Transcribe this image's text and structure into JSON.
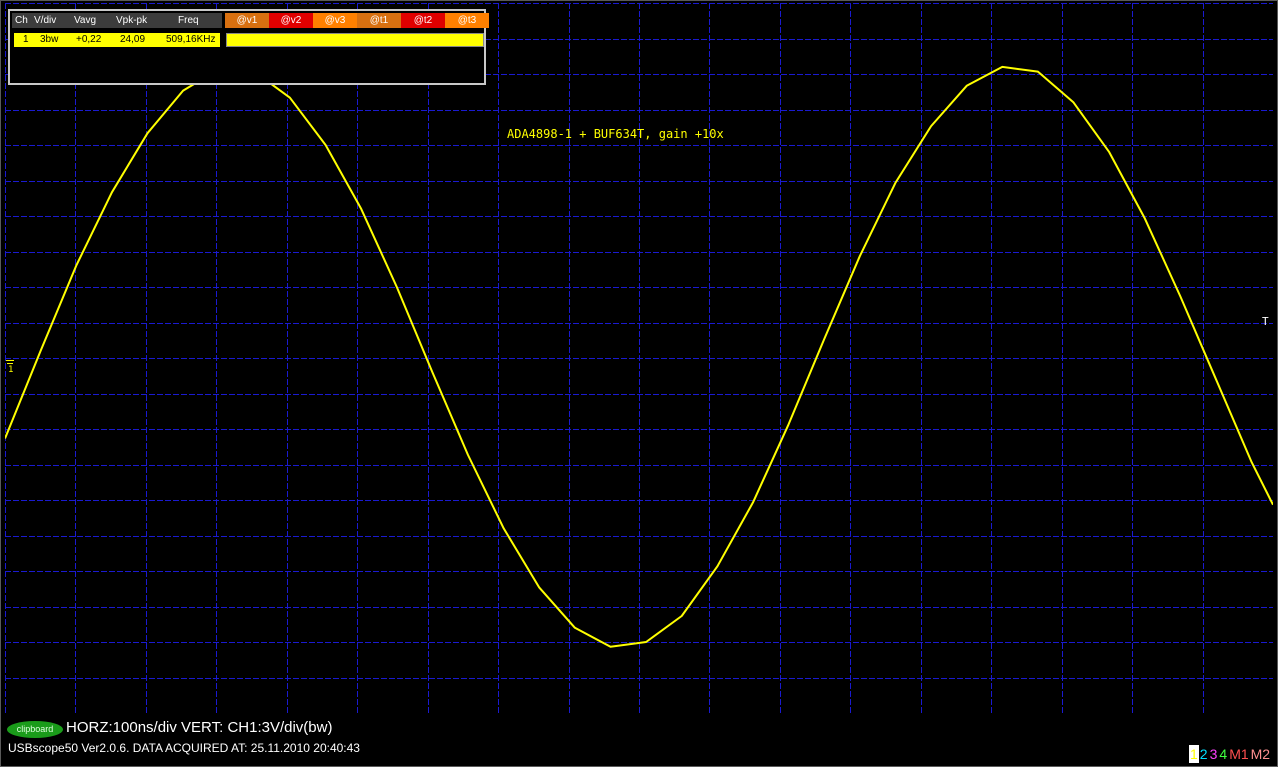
{
  "measurement_panel": {
    "headers": [
      "Ch",
      "V/div",
      "Vavg",
      "Vpk-pk",
      "Freq"
    ],
    "cursor_headers": [
      {
        "label": "@v1",
        "color": "#d87010"
      },
      {
        "label": "@v2",
        "color": "#e00000"
      },
      {
        "label": "@v3",
        "color": "#ff8000"
      },
      {
        "label": "@t1",
        "color": "#d87010"
      },
      {
        "label": "@t2",
        "color": "#e00000"
      },
      {
        "label": "@t3",
        "color": "#ff8000"
      }
    ],
    "row": {
      "ch": "1",
      "vdiv": "3bw",
      "vavg": "+0,22",
      "vpkpk": "24,09",
      "freq": "509,16KHz"
    }
  },
  "annotation": "ADA4898-1 + BUF634T, gain +10x",
  "status": {
    "clipboard_label": "clipboard",
    "horizontal_vertical": "HORZ:100ns/div VERT: CH1:3V/div(bw)",
    "version": "USBscope50 Ver2.0.6.  DATA ACQUIRED AT: 25.11.2010 20:40:43"
  },
  "channel_buttons": [
    {
      "label": "1",
      "color": "#ffff00",
      "bg": "#ffffff"
    },
    {
      "label": "2",
      "color": "#00e0ff",
      "bg": "#000000"
    },
    {
      "label": "3",
      "color": "#ff40ff",
      "bg": "#000000"
    },
    {
      "label": "4",
      "color": "#40ff40",
      "bg": "#000000"
    },
    {
      "label": "M1",
      "color": "#ff5050",
      "bg": "#000000"
    },
    {
      "label": "M2",
      "color": "#ff9090",
      "bg": "#000000"
    }
  ],
  "markers": {
    "ground": "1",
    "trigger": "T"
  },
  "colors": {
    "grid": "#1a1ad0",
    "trace": "#ffff00",
    "background": "#000000"
  },
  "chart_data": {
    "type": "line",
    "xlabel": "",
    "ylabel": "",
    "x_units": "ns",
    "y_units": "V",
    "x_per_div": 100,
    "y_per_div": 3,
    "xlim": [
      0,
      1780
    ],
    "ylim": [
      -15,
      15
    ],
    "grid": true,
    "series": [
      {
        "name": "",
        "frequency_khz": 509.16,
        "amplitude_v": 12.045,
        "offset_v": 0.22,
        "x": [
          0,
          50,
          100,
          150,
          200,
          250,
          300,
          350,
          400,
          450,
          500,
          550,
          600,
          650,
          700,
          750,
          800,
          850,
          900,
          950,
          1000,
          1050,
          1100,
          1150,
          1200,
          1250,
          1300,
          1350,
          1400,
          1450,
          1500,
          1550,
          1600,
          1650,
          1700,
          1750,
          1780
        ],
        "y": [
          -3.4,
          0.3,
          3.9,
          7.0,
          9.5,
          11.3,
          12.2,
          12.1,
          11.0,
          9.0,
          6.3,
          3.0,
          -0.6,
          -4.1,
          -7.2,
          -9.7,
          -11.4,
          -12.2,
          -12.0,
          -10.9,
          -8.8,
          -6.1,
          -2.8,
          0.8,
          4.3,
          7.4,
          9.8,
          11.5,
          12.3,
          12.1,
          10.8,
          8.7,
          5.9,
          2.6,
          -0.9,
          -4.4,
          -6.2
        ]
      }
    ]
  }
}
